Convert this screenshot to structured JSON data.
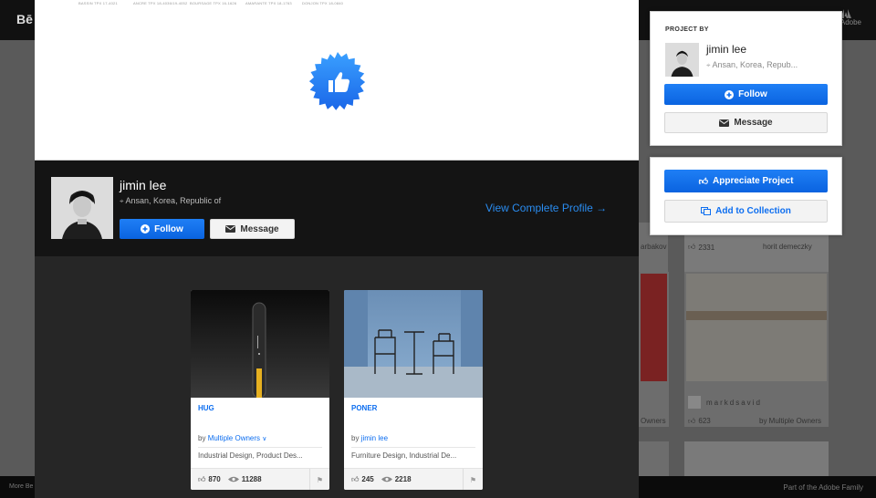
{
  "background": {
    "logo": "Bē",
    "adobe_label": "Adobe",
    "card_meta": [
      {
        "left": "arbakov",
        "right_likes": "2331",
        "right_owner": "horit demeczky"
      },
      {
        "likes_a": "623",
        "owner_a": "by Multiple Owners",
        "name": "markdsavid",
        "owners_left": "Owners"
      }
    ],
    "bottom_left": "More Be",
    "bottom_right": "Part of the Adobe Family"
  },
  "project": {
    "color_labels": [
      "BASSIN TPX 17-4021",
      "ANCRE TPX 18-4036/19-4052",
      "BOURSAGE TPX 16-1626",
      "AMARANTE TPX 18-1763",
      "DONJON TPX 18-0840"
    ],
    "appreciate_icon": "thumbs-up-icon"
  },
  "owner": {
    "name": "jimin lee",
    "location": "Ansan, Korea, Republic of",
    "follow_label": "Follow",
    "message_label": "Message",
    "view_profile": "View Complete Profile →"
  },
  "projects": [
    {
      "title": "HUG",
      "by_prefix": "by",
      "by": "Multiple Owners",
      "fields": "Industrial Design, Product Des...",
      "likes": "870",
      "views": "11288"
    },
    {
      "title": "PONER",
      "by_prefix": "by",
      "by": "jimin lee",
      "fields": "Furniture Design, Industrial De...",
      "likes": "245",
      "views": "2218"
    }
  ],
  "sidebar": {
    "project_by_label": "PROJECT BY",
    "name": "jimin lee",
    "location": "Ansan, Korea, Repub...",
    "follow_label": "Follow",
    "message_label": "Message",
    "appreciate_label": "Appreciate Project",
    "collection_label": "Add to Collection"
  },
  "colors": {
    "accent": "#0d6ef0",
    "link": "#2a8cf0"
  }
}
